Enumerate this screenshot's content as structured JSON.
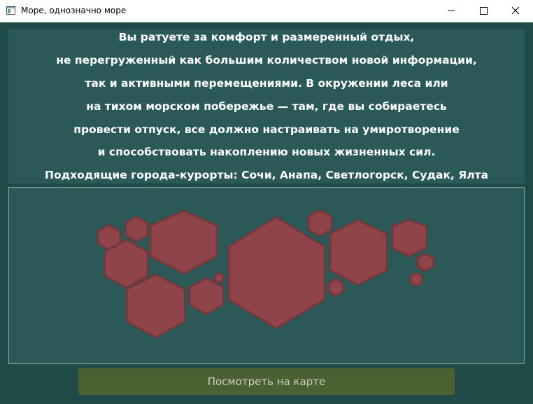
{
  "window": {
    "title": "Море, однозначно море",
    "icon": "app-window-icon",
    "controls": {
      "minimize_icon": "minimize-icon",
      "maximize_icon": "maximize-icon",
      "close_icon": "close-icon"
    }
  },
  "description": {
    "lines": [
      "Вы ратуете за комфорт и размеренный отдых,",
      "не перегруженный как большим количеством новой информации,",
      "так и активными перемещениями. В окружении леса или",
      "на тихом морском побережье — там, где вы собираетесь",
      "провести отпуск, все должно настраивать на умиротворение",
      "и способствовать накоплению новых жизненных сил.",
      "Подходящие города-курорты: Сочи, Анапа, Светлогорск, Судак, Ялта"
    ]
  },
  "illustration": {
    "icon": "hexagon-cluster-image",
    "hex_fill": "#8f4449",
    "hex_stroke": "#6e3a3e"
  },
  "actions": {
    "map_button_label": "Посмотреть на карте"
  },
  "colors": {
    "window_bg": "#1f4a48",
    "panel_bg": "#2a5958",
    "button_bg": "#4c6132",
    "button_text": "#c9d2c0",
    "text": "#ffffff"
  }
}
